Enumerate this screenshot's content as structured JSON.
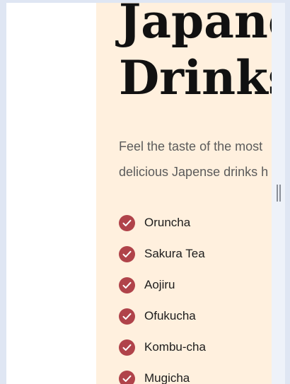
{
  "colors": {
    "page_bg": "#dfe6f3",
    "hero_bg": "#fff0de",
    "title": "#111111",
    "text": "#5b5b5b",
    "check_bg": "#b0434a"
  },
  "hero": {
    "title_lines": [
      "Japanes",
      "Drinks"
    ],
    "description_lines": [
      "Feel the taste of the most",
      "delicious Japense drinks h"
    ]
  },
  "drinks": {
    "icon": "check-circle-icon",
    "items": [
      "Oruncha",
      "Sakura Tea",
      "Aojiru",
      "Ofukucha",
      "Kombu-cha",
      "Mugicha"
    ]
  }
}
